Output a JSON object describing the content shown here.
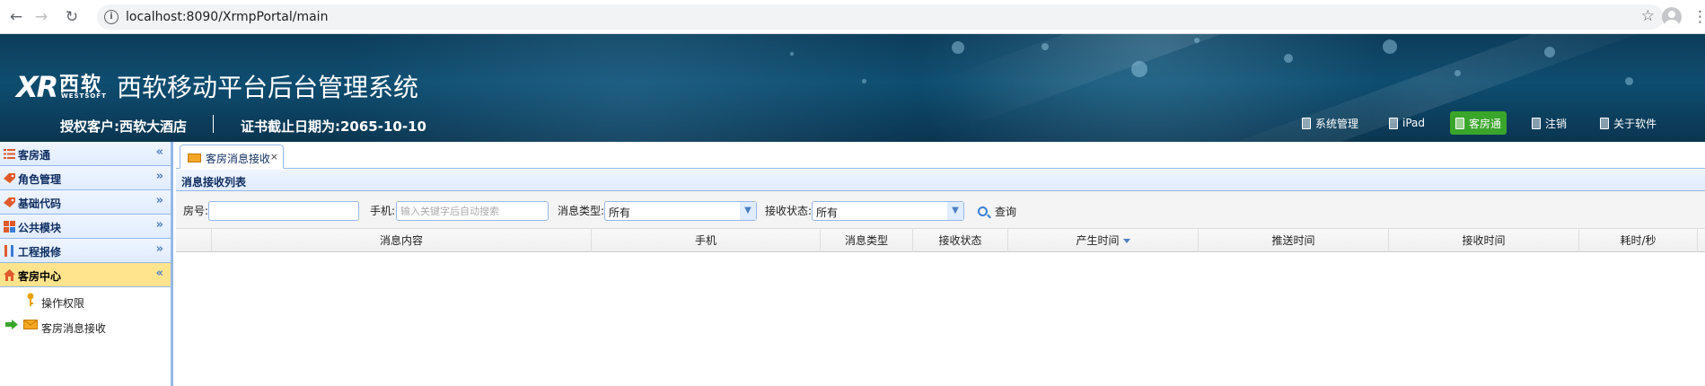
{
  "browser": {
    "url": "localhost:8090/XrmpPortal/main",
    "back_icon": "back-arrow-icon",
    "forward_icon": "forward-arrow-icon",
    "reload_icon": "reload-icon"
  },
  "header": {
    "logo_mark": "XR",
    "logo_cn": "西软",
    "logo_en": "WESTSOFT",
    "system_title": "西软移动平台后台管理系统",
    "license_label": "授权客户:西软大酒店",
    "expire_label": "证书截止日期为:2065-10-10",
    "nav": [
      {
        "label": "系统管理",
        "active": false
      },
      {
        "label": "iPad",
        "active": false
      },
      {
        "label": "客房通",
        "active": true
      },
      {
        "label": "注销",
        "active": false
      },
      {
        "label": "关于软件",
        "active": false
      }
    ],
    "active_color": "#3aa52b"
  },
  "sidebar": {
    "sections": [
      {
        "label": "客房通",
        "toggle": "«",
        "icon": "list-icon",
        "open": false
      },
      {
        "label": "角色管理",
        "toggle": "»",
        "icon": "tag-icon",
        "open": false
      },
      {
        "label": "基础代码",
        "toggle": "»",
        "icon": "tag-icon",
        "open": false
      },
      {
        "label": "公共模块",
        "toggle": "»",
        "icon": "modules-icon",
        "open": false
      },
      {
        "label": "工程报修",
        "toggle": "»",
        "icon": "tools-icon",
        "open": false
      },
      {
        "label": "客房中心",
        "toggle": "«",
        "icon": "home-icon",
        "open": true
      }
    ],
    "items": [
      {
        "label": "操作权限",
        "icon": "key-icon"
      },
      {
        "label": "客房消息接收",
        "icon": "mail-icon"
      }
    ]
  },
  "tabs": [
    {
      "label": "客房消息接收",
      "close": "×"
    }
  ],
  "panel": {
    "title": "消息接收列表"
  },
  "filters": {
    "room_label": "房号:",
    "room_value": "",
    "phone_label": "手机:",
    "phone_placeholder": "输入关键字后自动搜索",
    "type_label": "消息类型:",
    "type_value": "所有",
    "status_label": "接收状态:",
    "status_value": "所有",
    "search_label": "查询"
  },
  "grid": {
    "columns": [
      "消息内容",
      "手机",
      "消息类型",
      "接收状态",
      "产生时间",
      "推送时间",
      "接收时间",
      "耗时/秒"
    ],
    "sorted_column": "产生时间",
    "rows": []
  }
}
